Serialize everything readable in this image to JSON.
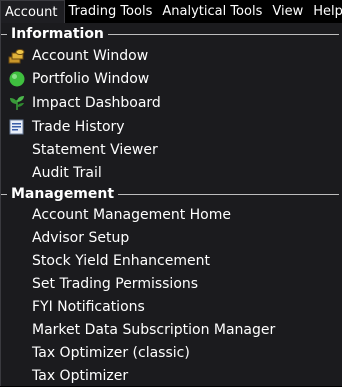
{
  "menubar": {
    "items": [
      {
        "label": "Account",
        "active": true
      },
      {
        "label": "Trading Tools",
        "active": false
      },
      {
        "label": "Analytical Tools",
        "active": false
      },
      {
        "label": "View",
        "active": false
      },
      {
        "label": "Help",
        "active": false
      }
    ]
  },
  "dropdown": {
    "sections": [
      {
        "title": "Information",
        "items": [
          {
            "label": "Account Window",
            "icon": "money-stack-icon"
          },
          {
            "label": "Portfolio Window",
            "icon": "globe-icon"
          },
          {
            "label": "Impact Dashboard",
            "icon": "leaf-icon"
          },
          {
            "label": "Trade History",
            "icon": "document-icon"
          },
          {
            "label": "Statement Viewer",
            "icon": ""
          },
          {
            "label": "Audit Trail",
            "icon": ""
          }
        ]
      },
      {
        "title": "Management",
        "items": [
          {
            "label": "Account Management Home"
          },
          {
            "label": "Advisor Setup"
          },
          {
            "label": "Stock Yield Enhancement"
          },
          {
            "label": "Set Trading Permissions"
          },
          {
            "label": "FYI Notifications"
          },
          {
            "label": "Market Data Subscription Manager"
          },
          {
            "label": "Tax Optimizer (classic)"
          },
          {
            "label": "Tax Optimizer"
          }
        ]
      }
    ]
  },
  "colors": {
    "background": "#000000",
    "menu_background": "#1b1b1e",
    "text": "#ffffff",
    "globe": "#3fbf3f",
    "leaf": "#3a9a3a",
    "coins": "#d4a62a"
  }
}
